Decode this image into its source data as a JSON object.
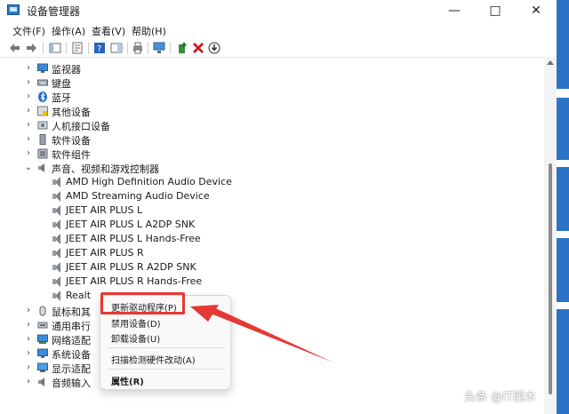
{
  "window": {
    "title": "设备管理器",
    "controls": {
      "minimize": "—",
      "maximize": "□",
      "close": "✕"
    }
  },
  "menubar": {
    "items": [
      "文件(F)",
      "操作(A)",
      "查看(V)",
      "帮助(H)"
    ]
  },
  "tree": {
    "categories_top": [
      {
        "label": "监视器",
        "icon": "monitor-icon"
      },
      {
        "label": "键盘",
        "icon": "keyboard-icon"
      },
      {
        "label": "蓝牙",
        "icon": "bluetooth-icon"
      },
      {
        "label": "其他设备",
        "icon": "unknown-device-icon"
      },
      {
        "label": "人机接口设备",
        "icon": "hid-icon"
      },
      {
        "label": "软件设备",
        "icon": "software-device-icon"
      },
      {
        "label": "软件组件",
        "icon": "software-component-icon"
      }
    ],
    "expanded_category": {
      "label": "声音、视频和游戏控制器",
      "icon": "sound-icon"
    },
    "audio_devices": [
      "AMD High Definition Audio Device",
      "AMD Streaming Audio Device",
      "JEET AIR PLUS L",
      "JEET AIR PLUS L A2DP SNK",
      "JEET AIR PLUS L Hands-Free",
      "JEET AIR PLUS R",
      "JEET AIR PLUS R A2DP SNK",
      "JEET AIR PLUS R Hands-Free",
      "Realt"
    ],
    "categories_bottom": [
      {
        "label": "鼠标和其",
        "icon": "mouse-icon"
      },
      {
        "label": "通用串行",
        "icon": "usb-icon"
      },
      {
        "label": "网络适配",
        "icon": "network-icon"
      },
      {
        "label": "系统设备",
        "icon": "system-device-icon"
      },
      {
        "label": "显示适配",
        "icon": "display-adapter-icon"
      },
      {
        "label": "音频输入",
        "icon": "audio-input-icon"
      }
    ]
  },
  "context_menu": {
    "items": [
      "更新驱动程序(P)",
      "禁用设备(D)",
      "卸载设备(U)",
      "扫描检测硬件改动(A)",
      "属性(R)"
    ]
  },
  "watermark": "头条 @IT西木",
  "colors": {
    "highlight": "#e53935",
    "accent": "#2b73c7"
  }
}
